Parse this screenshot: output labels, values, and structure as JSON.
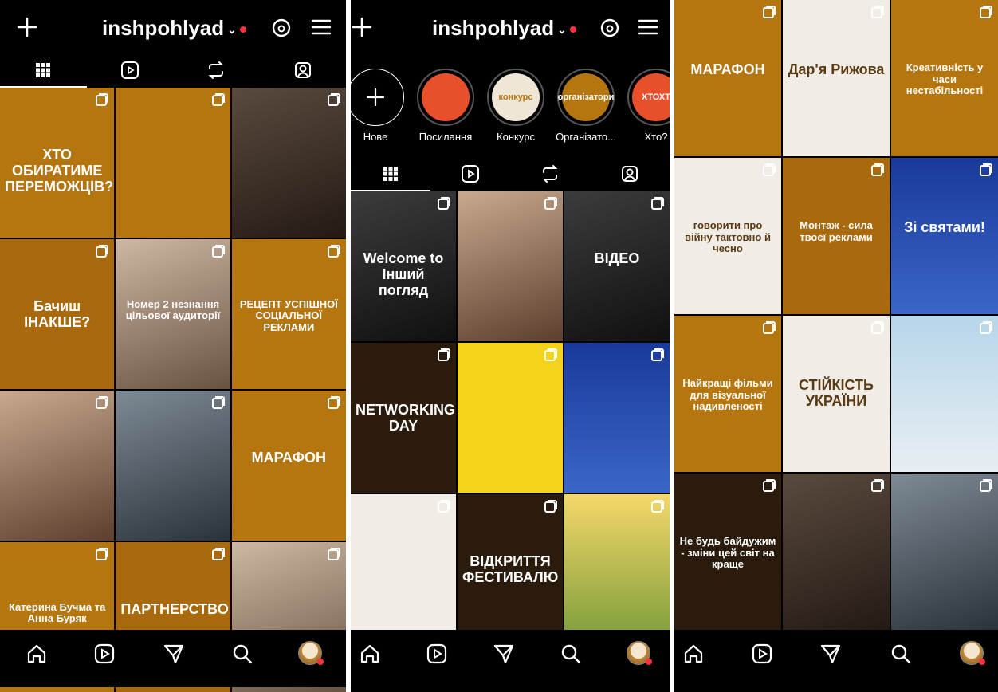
{
  "profile": {
    "username": "inshpohlyad"
  },
  "panel1": {
    "tiles": [
      {
        "text": "ХТО ОБИРАТИМЕ ПЕРЕМОЖЦІВ?",
        "style": "ochre"
      },
      {
        "text": "",
        "style": "ochre"
      },
      {
        "text": "",
        "style": "photo1"
      },
      {
        "text": "Бачиш ІНАКШЕ?",
        "style": "ochre2"
      },
      {
        "text": "Номер 2 незнання цільової аудиторії",
        "style": "photo2"
      },
      {
        "text": "РЕЦЕПТ УСПІШНОЇ СОЦІАЛЬНОЇ РЕКЛАМИ",
        "style": "ochre"
      },
      {
        "text": "",
        "style": "photo4"
      },
      {
        "text": "",
        "style": "photo3"
      },
      {
        "text": "МАРАФОН",
        "style": "ochre"
      },
      {
        "text": "Катерина Бучма та Анна Буряк",
        "style": "ochre"
      },
      {
        "text": "ПАРТНЕРСТВО",
        "style": "ochre2"
      },
      {
        "text": "",
        "style": "photo2"
      }
    ]
  },
  "panel2": {
    "stories": [
      {
        "label": "Нове",
        "inner": ""
      },
      {
        "label": "Посилання",
        "inner": ""
      },
      {
        "label": "Конкурс",
        "inner": "конкурс"
      },
      {
        "label": "Організато...",
        "inner": "організатори"
      },
      {
        "label": "Хто?",
        "inner": "ХТОХТ"
      }
    ],
    "tiles": [
      {
        "text": "Welcome to Інший погляд",
        "style": "photo5"
      },
      {
        "text": "",
        "style": "photo4"
      },
      {
        "text": "ВІДЕО",
        "style": "photo5"
      },
      {
        "text": "NETWORKING DAY",
        "style": "darkbrown"
      },
      {
        "text": "",
        "style": "yellow"
      },
      {
        "text": "",
        "style": "blue"
      },
      {
        "text": "",
        "style": "cream"
      },
      {
        "text": "ВІДКРИТТЯ ФЕСТИВАЛЮ",
        "style": "darkbrown"
      },
      {
        "text": "",
        "style": "sun"
      }
    ]
  },
  "panel3": {
    "tiles": [
      {
        "text": "МАРАФОН",
        "style": "ochre"
      },
      {
        "text": "Дар'я Рижова",
        "style": "cream"
      },
      {
        "text": "Креативність у часи нестабільності",
        "style": "ochre"
      },
      {
        "text": "говорити про війну тактовно й чесно",
        "style": "cream"
      },
      {
        "text": "Монтаж - сила твоєї реклами",
        "style": "ochre2"
      },
      {
        "text": "Зі святами!",
        "style": "blue"
      },
      {
        "text": "Найкращі фільми для візуальної надивленості",
        "style": "ochre"
      },
      {
        "text": "СТІЙКІСТЬ УКРАЇНИ",
        "style": "cream"
      },
      {
        "text": "",
        "style": "winter"
      },
      {
        "text": "Не будь байдужим - зміни цей світ на краще",
        "style": "darkbrown"
      },
      {
        "text": "",
        "style": "photo1"
      },
      {
        "text": "",
        "style": "photo3"
      }
    ]
  },
  "colors": {
    "background": "#000000",
    "accent_red": "#ff3040",
    "brand_ochre": "#b5760f"
  }
}
